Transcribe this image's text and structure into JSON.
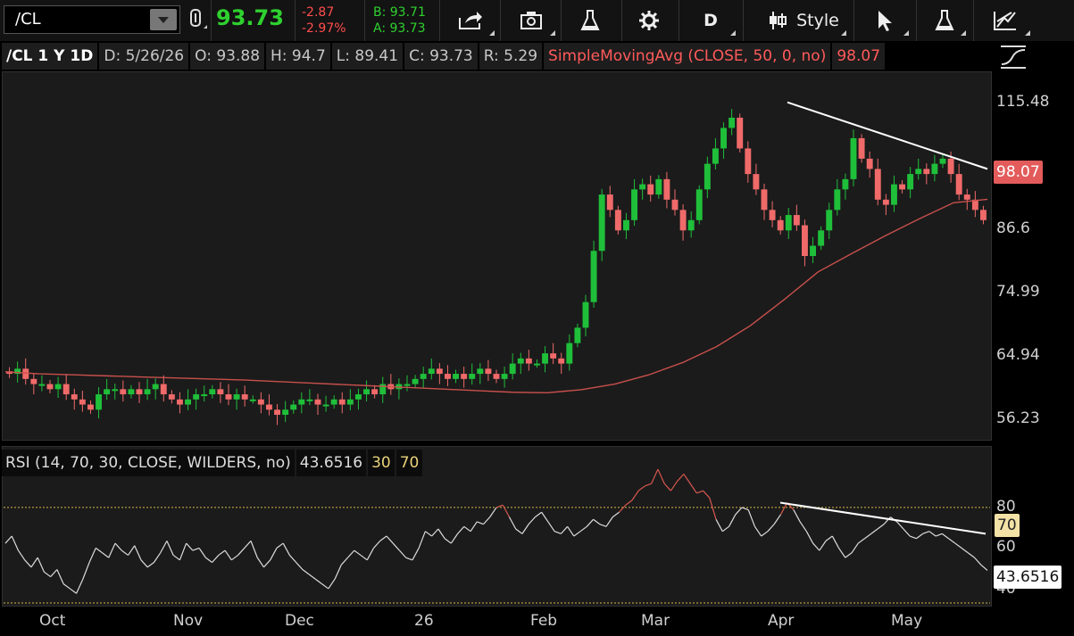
{
  "toolbar": {
    "symbol": "/CL",
    "last": "93.73",
    "change": "-2.87",
    "change_pct": "-2.97%",
    "bid": "B: 93.71",
    "ask": "A: 93.73",
    "period_button": "D",
    "style_button": "Style"
  },
  "infobar": {
    "symbol": "/CL 1 Y 1D",
    "date": "D: 5/26/26",
    "open": "O: 93.88",
    "high": "H: 94.7",
    "low": "L: 89.41",
    "close": "C: 93.73",
    "range": "R: 5.29",
    "sma_label": "SimpleMovingAvg (CLOSE, 50, 0, no)",
    "sma_value": "98.07"
  },
  "price_axis": {
    "ticks": [
      "115.48",
      "86.6",
      "74.99",
      "64.94",
      "56.23"
    ],
    "sma_badge": "98.07"
  },
  "rsi": {
    "label": "RSI (14, 70, 30, CLOSE, WILDERS, no)",
    "value": "43.6516",
    "oversold": "30",
    "overbought": "70",
    "ticks": [
      "80",
      "60",
      "40"
    ],
    "level_badge": "70",
    "value_badge": "43.6516"
  },
  "x_axis": [
    "Oct",
    "Nov",
    "Dec",
    "26",
    "Feb",
    "Mar",
    "Apr",
    "May"
  ],
  "colors": {
    "up": "#1fbf3a",
    "down": "#f06a6a",
    "sma": "#c9504c",
    "rsi": "#dcdcdc",
    "rsi_over": "#d9584f",
    "level": "#d6b64a"
  },
  "chart_data": [
    {
      "type": "candlestick",
      "title": "/CL 1 Y 1D",
      "x_labels": [
        "Oct",
        "Nov",
        "Dec",
        "26",
        "Feb",
        "Mar",
        "Apr",
        "May"
      ],
      "ylim": [
        52,
        122
      ],
      "y_ticks": [
        56.23,
        64.94,
        74.99,
        86.6,
        115.48
      ],
      "last_bar": {
        "date": "5/26/26",
        "open": 93.88,
        "high": 94.7,
        "low": 89.41,
        "close": 93.73
      },
      "sma": {
        "name": "SimpleMovingAvg (CLOSE, 50, 0, no)",
        "last": 98.07,
        "values": [
          64.4,
          64.0,
          63.8,
          63.6,
          63.4,
          63.2,
          63.0,
          62.8,
          62.5,
          62.2,
          61.9,
          61.6,
          61.3,
          61.0,
          60.7,
          60.4,
          60.3,
          60.9,
          62.0,
          63.8,
          66.2,
          69.3,
          73.4,
          78.5,
          83.9,
          87.5,
          91.0,
          94.3,
          97.4,
          98.07
        ]
      },
      "trendline": {
        "from": [
          117,
          "Apr"
        ],
        "to": [
          104,
          "late May"
        ]
      },
      "closes": [
        64,
        65,
        63,
        62,
        62,
        61,
        62,
        60,
        59,
        58,
        57,
        60,
        61,
        61,
        60,
        61,
        60,
        61,
        62,
        60,
        59,
        58,
        59,
        60,
        60,
        61,
        60,
        59,
        60,
        59,
        59,
        58,
        57,
        56,
        57,
        58,
        59,
        59,
        58,
        58,
        59,
        58,
        59,
        60,
        61,
        60,
        62,
        61,
        62,
        62,
        63,
        64,
        65,
        64,
        63,
        64,
        63,
        64,
        65,
        64,
        63,
        64,
        66,
        67,
        66,
        66,
        68,
        67,
        66,
        70,
        73,
        78,
        88,
        99,
        96,
        92,
        94,
        100,
        101,
        99,
        102,
        98,
        96,
        92,
        94,
        100,
        105,
        108,
        112,
        114,
        108,
        103,
        100,
        96,
        94,
        92,
        95,
        93,
        87,
        89,
        92,
        96,
        100,
        102,
        110,
        106,
        104,
        98,
        97,
        101,
        100,
        103,
        104,
        103,
        105,
        106,
        103,
        99,
        98,
        96,
        94
      ]
    },
    {
      "type": "line",
      "title": "RSI (14, 70, 30, CLOSE, WILDERS, no)",
      "ylim": [
        30,
        92
      ],
      "y_ticks": [
        40,
        60,
        80
      ],
      "levels": [
        70,
        30
      ],
      "last": 43.6516,
      "values": [
        55,
        58,
        52,
        48,
        45,
        49,
        43,
        41,
        44,
        38,
        36,
        34,
        40,
        47,
        53,
        51,
        49,
        55,
        52,
        50,
        54,
        48,
        45,
        47,
        51,
        56,
        50,
        48,
        55,
        52,
        53,
        49,
        47,
        50,
        52,
        48,
        50,
        53,
        56,
        49,
        45,
        48,
        53,
        55,
        50,
        47,
        44,
        42,
        40,
        38,
        36,
        40,
        46,
        49,
        52,
        50,
        48,
        53,
        56,
        58,
        55,
        52,
        49,
        48,
        53,
        60,
        58,
        61,
        57,
        55,
        59,
        62,
        60,
        64,
        63,
        66,
        70,
        71,
        66,
        61,
        59,
        63,
        66,
        68,
        64,
        60,
        59,
        62,
        58,
        60,
        62,
        65,
        63,
        62,
        66,
        68,
        71,
        73,
        77,
        79,
        80,
        86,
        80,
        77,
        81,
        84,
        80,
        76,
        77,
        74,
        65,
        60,
        62,
        67,
        70,
        69,
        62,
        58,
        60,
        63,
        67,
        72,
        69,
        64,
        60,
        55,
        52,
        56,
        58,
        53,
        49,
        51,
        55,
        57,
        59,
        61,
        63,
        66,
        64,
        61,
        58,
        57,
        59,
        60,
        58,
        59,
        57,
        55,
        53,
        51,
        49,
        46,
        43.6516
      ]
    }
  ]
}
